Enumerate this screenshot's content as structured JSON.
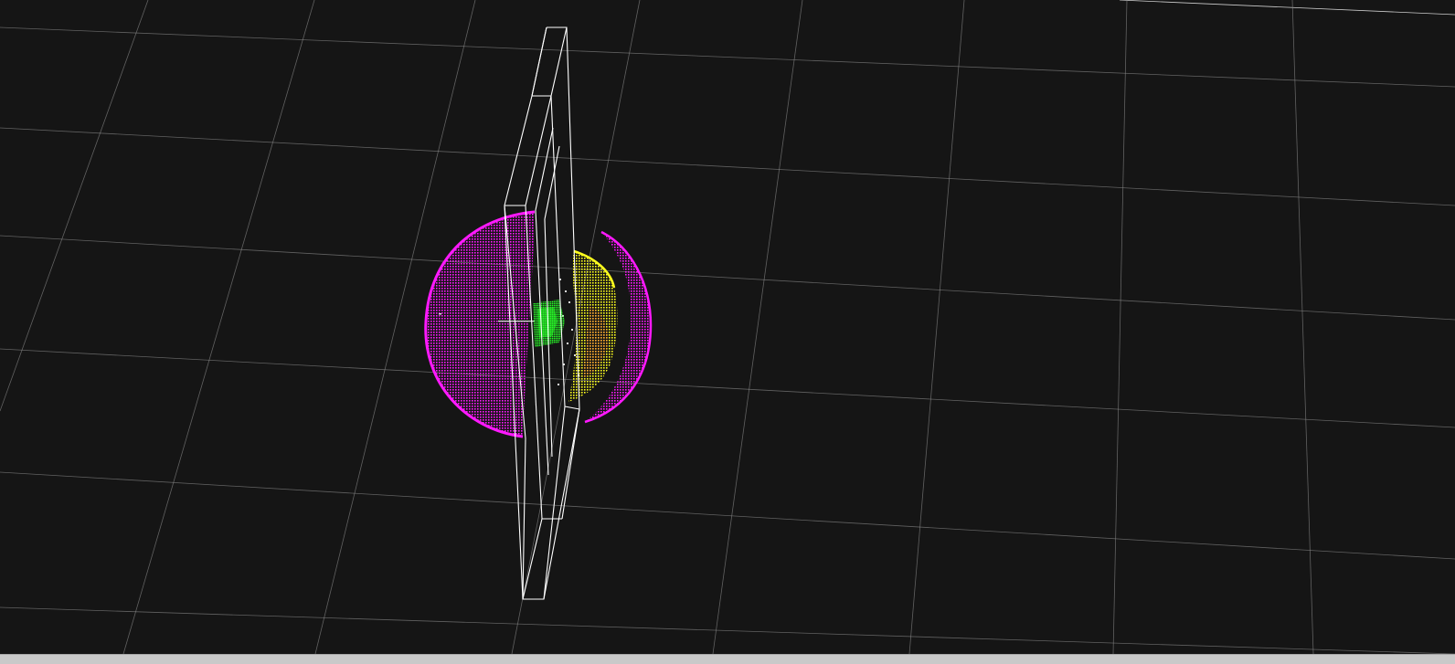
{
  "viewport": {
    "background_color": "#151515",
    "grid_color": "#8a8a8a",
    "frame_color": "#ffffff"
  },
  "point_clouds": [
    {
      "name": "magenta-sphere-cloud",
      "color": "#ff19ff"
    },
    {
      "name": "yellow-surface-cloud",
      "color": "#ffff1e"
    },
    {
      "name": "orange-surface-cloud",
      "color": "#ff9e32"
    },
    {
      "name": "green-center-cloud",
      "color": "#28ff28"
    },
    {
      "name": "white-noise-cloud",
      "color": "#dedede"
    }
  ],
  "status_bar": {
    "color": "#c9c9c9"
  }
}
